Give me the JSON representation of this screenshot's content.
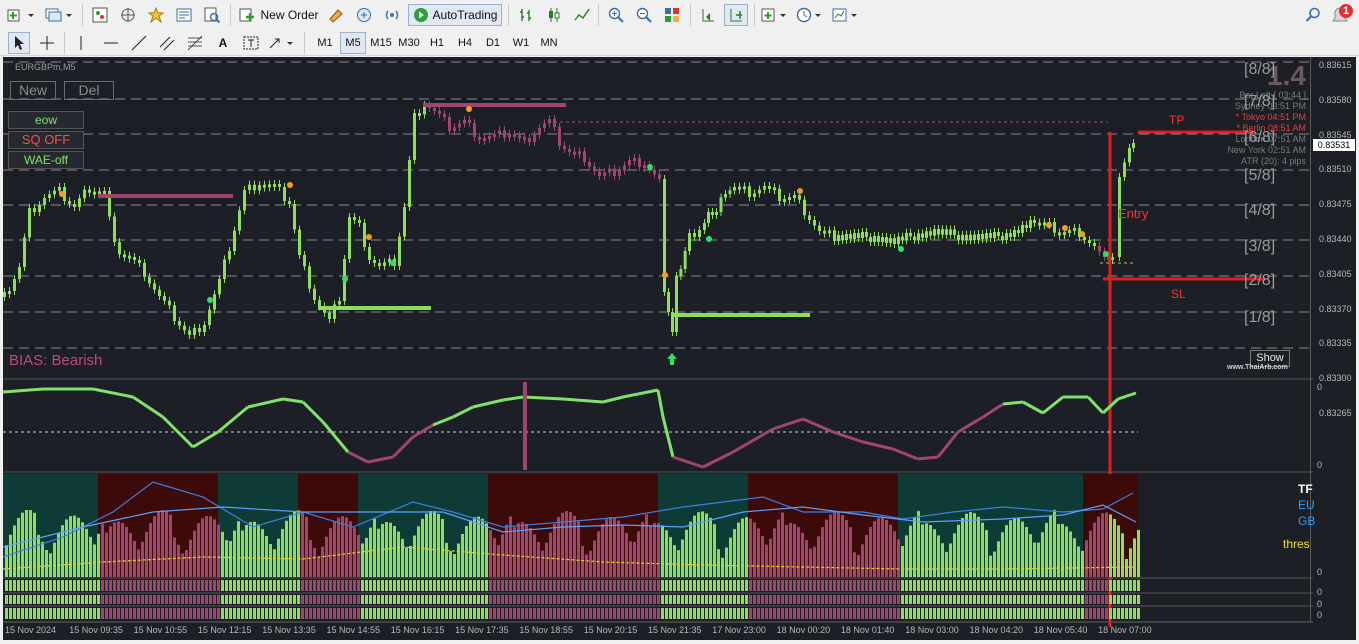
{
  "toolbar": {
    "new_order": "New Order",
    "autotrading": "AutoTrading",
    "notification_count": "1"
  },
  "timeframes": [
    "M1",
    "M5",
    "M15",
    "M30",
    "H1",
    "H4",
    "D1",
    "W1",
    "MN"
  ],
  "active_timeframe": "M5",
  "chart": {
    "symbol": "EURGBPm,M5",
    "buttons": {
      "new": "New",
      "del": "Del"
    },
    "toggles": {
      "eow": "eow",
      "sq": "SQ OFF",
      "wae": "WAE-off"
    },
    "bias": "BIAS: Bearish",
    "big_value": "1.4",
    "murrey_levels": [
      "[8/8]",
      "[7/8]",
      "[6/8]",
      "[5/8]",
      "[4/8]",
      "[3/8]",
      "[2/8]",
      "[1/8]"
    ],
    "sessions": {
      "bar_left": "Bar Left  [ 03:44 ]",
      "sydney": "Sydney  03:51 PM",
      "tokyo": "* Tokyo  04:51 PM",
      "berlin": "* Berlin  08:51 AM",
      "london": "London  07:51 AM",
      "newyork": "New York  02:51 AM",
      "atr": "ATR (20): 4 pips"
    },
    "trade": {
      "tp": "TP",
      "entry": "Entry",
      "sl": "SL"
    },
    "show_button": "Show",
    "watermark": "www.ThaiArb.com",
    "price_ticks": [
      "0.83615",
      "0.83580",
      "0.83545",
      "0.83510",
      "0.83475",
      "0.83440",
      "0.83405",
      "0.83370",
      "0.83335",
      "0.83300",
      "0.83265"
    ],
    "current_price": "0.83531",
    "time_labels": [
      "15 Nov 2024",
      "15 Nov 09:35",
      "15 Nov 10:55",
      "15 Nov 12:15",
      "15 Nov 13:35",
      "15 Nov 14:55",
      "15 Nov 16:15",
      "15 Nov 17:35",
      "15 Nov 18:55",
      "15 Nov 20:15",
      "15 Nov 21:35",
      "17 Nov 23:00",
      "18 Nov 00:20",
      "18 Nov 01:40",
      "18 Nov 03:00",
      "18 Nov 04:20",
      "18 Nov 05:40",
      "18 Nov 07:00"
    ],
    "osc_scale": [
      "0",
      "0"
    ],
    "legend": {
      "tf": "TF",
      "eu": "EU",
      "gb": "GB",
      "thres": "thres"
    },
    "sub_scale": [
      "0",
      "0",
      "0",
      "0"
    ]
  },
  "colors": {
    "bull": "#8fdc5e",
    "bear": "#a0466e",
    "red": "#e02020",
    "gold": "#f0a020",
    "teal": "#0f3b37",
    "maroon": "#3d0a0a"
  }
}
